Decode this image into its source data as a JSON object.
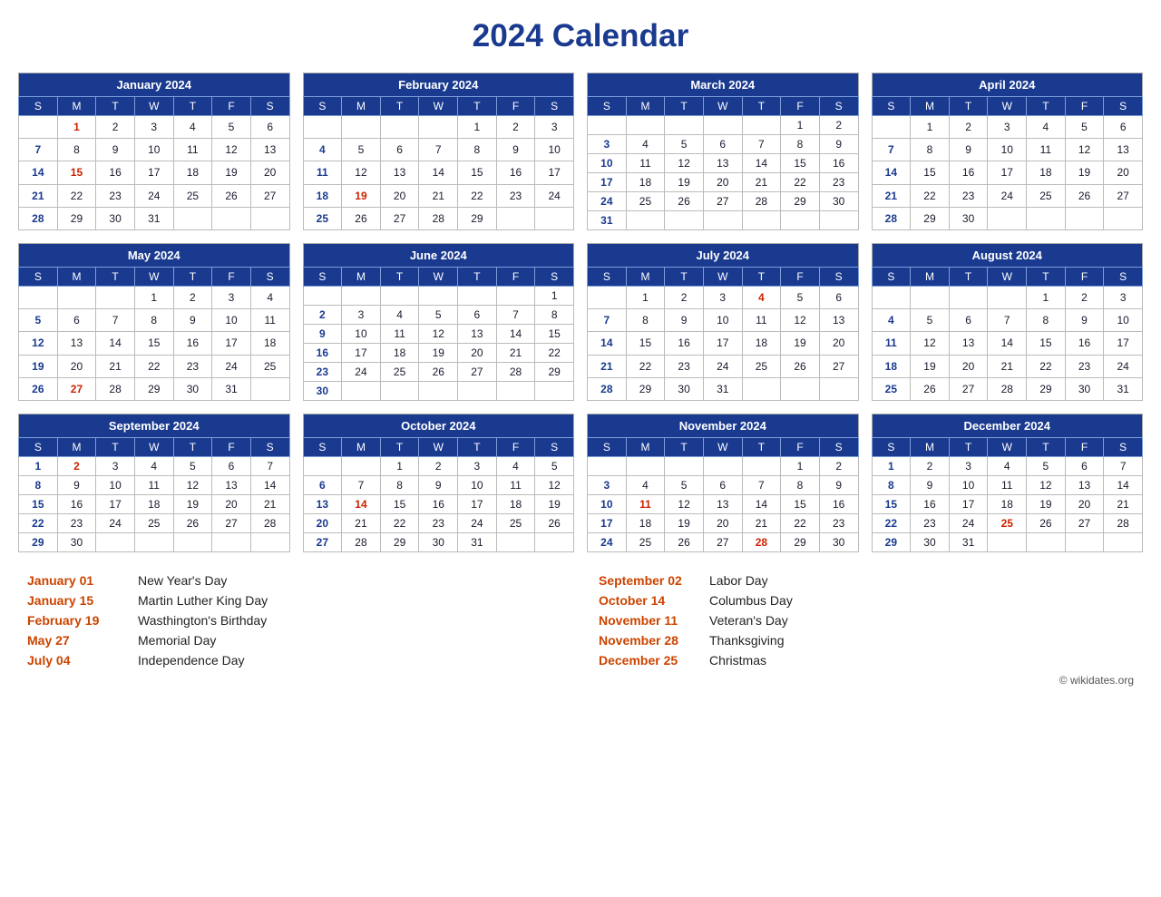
{
  "title": "2024 Calendar",
  "copyright": "© wikidates.org",
  "months": [
    {
      "name": "January 2024",
      "days_header": [
        "S",
        "M",
        "T",
        "W",
        "T",
        "F",
        "S"
      ],
      "weeks": [
        [
          "",
          "1",
          "2",
          "3",
          "4",
          "5",
          "6"
        ],
        [
          "7",
          "8",
          "9",
          "10",
          "11",
          "12",
          "13"
        ],
        [
          "14",
          "15",
          "16",
          "17",
          "18",
          "19",
          "20"
        ],
        [
          "21",
          "22",
          "23",
          "24",
          "25",
          "26",
          "27"
        ],
        [
          "28",
          "29",
          "30",
          "31",
          "",
          "",
          ""
        ]
      ],
      "holidays": [
        "1",
        "15"
      ],
      "sundays": [
        "7",
        "14",
        "21",
        "28"
      ]
    },
    {
      "name": "February 2024",
      "days_header": [
        "S",
        "M",
        "T",
        "W",
        "T",
        "F",
        "S"
      ],
      "weeks": [
        [
          "",
          "",
          "",
          "",
          "1",
          "2",
          "3"
        ],
        [
          "4",
          "5",
          "6",
          "7",
          "8",
          "9",
          "10"
        ],
        [
          "11",
          "12",
          "13",
          "14",
          "15",
          "16",
          "17"
        ],
        [
          "18",
          "19",
          "20",
          "21",
          "22",
          "23",
          "24"
        ],
        [
          "25",
          "26",
          "27",
          "28",
          "29",
          "",
          ""
        ]
      ],
      "holidays": [
        "19"
      ],
      "sundays": [
        "4",
        "11",
        "18",
        "25"
      ]
    },
    {
      "name": "March 2024",
      "days_header": [
        "S",
        "M",
        "T",
        "W",
        "T",
        "F",
        "S"
      ],
      "weeks": [
        [
          "",
          "",
          "",
          "",
          "",
          "1",
          "2"
        ],
        [
          "3",
          "4",
          "5",
          "6",
          "7",
          "8",
          "9"
        ],
        [
          "10",
          "11",
          "12",
          "13",
          "14",
          "15",
          "16"
        ],
        [
          "17",
          "18",
          "19",
          "20",
          "21",
          "22",
          "23"
        ],
        [
          "24",
          "25",
          "26",
          "27",
          "28",
          "29",
          "30"
        ],
        [
          "31",
          "",
          "",
          "",
          "",
          "",
          ""
        ]
      ],
      "holidays": [],
      "sundays": [
        "3",
        "10",
        "17",
        "24",
        "31"
      ]
    },
    {
      "name": "April 2024",
      "days_header": [
        "S",
        "M",
        "T",
        "W",
        "T",
        "F",
        "S"
      ],
      "weeks": [
        [
          "",
          "1",
          "2",
          "3",
          "4",
          "5",
          "6"
        ],
        [
          "7",
          "8",
          "9",
          "10",
          "11",
          "12",
          "13"
        ],
        [
          "14",
          "15",
          "16",
          "17",
          "18",
          "19",
          "20"
        ],
        [
          "21",
          "22",
          "23",
          "24",
          "25",
          "26",
          "27"
        ],
        [
          "28",
          "29",
          "30",
          "",
          "",
          "",
          ""
        ]
      ],
      "holidays": [],
      "sundays": [
        "7",
        "14",
        "21",
        "28"
      ]
    },
    {
      "name": "May 2024",
      "days_header": [
        "S",
        "M",
        "T",
        "W",
        "T",
        "F",
        "S"
      ],
      "weeks": [
        [
          "",
          "",
          "",
          "1",
          "2",
          "3",
          "4"
        ],
        [
          "5",
          "6",
          "7",
          "8",
          "9",
          "10",
          "11"
        ],
        [
          "12",
          "13",
          "14",
          "15",
          "16",
          "17",
          "18"
        ],
        [
          "19",
          "20",
          "21",
          "22",
          "23",
          "24",
          "25"
        ],
        [
          "26",
          "27",
          "28",
          "29",
          "30",
          "31",
          ""
        ]
      ],
      "holidays": [
        "27"
      ],
      "sundays": [
        "5",
        "12",
        "19",
        "26"
      ]
    },
    {
      "name": "June 2024",
      "days_header": [
        "S",
        "M",
        "T",
        "W",
        "T",
        "F",
        "S"
      ],
      "weeks": [
        [
          "",
          "",
          "",
          "",
          "",
          "",
          "1"
        ],
        [
          "2",
          "3",
          "4",
          "5",
          "6",
          "7",
          "8"
        ],
        [
          "9",
          "10",
          "11",
          "12",
          "13",
          "14",
          "15"
        ],
        [
          "16",
          "17",
          "18",
          "19",
          "20",
          "21",
          "22"
        ],
        [
          "23",
          "24",
          "25",
          "26",
          "27",
          "28",
          "29"
        ],
        [
          "30",
          "",
          "",
          "",
          "",
          "",
          ""
        ]
      ],
      "holidays": [],
      "sundays": [
        "2",
        "9",
        "16",
        "23",
        "30"
      ]
    },
    {
      "name": "July 2024",
      "days_header": [
        "S",
        "M",
        "T",
        "W",
        "T",
        "F",
        "S"
      ],
      "weeks": [
        [
          "",
          "1",
          "2",
          "3",
          "4",
          "5",
          "6"
        ],
        [
          "7",
          "8",
          "9",
          "10",
          "11",
          "12",
          "13"
        ],
        [
          "14",
          "15",
          "16",
          "17",
          "18",
          "19",
          "20"
        ],
        [
          "21",
          "22",
          "23",
          "24",
          "25",
          "26",
          "27"
        ],
        [
          "28",
          "29",
          "30",
          "31",
          "",
          "",
          ""
        ]
      ],
      "holidays": [
        "4"
      ],
      "sundays": [
        "7",
        "14",
        "21",
        "28"
      ]
    },
    {
      "name": "August 2024",
      "days_header": [
        "S",
        "M",
        "T",
        "W",
        "T",
        "F",
        "S"
      ],
      "weeks": [
        [
          "",
          "",
          "",
          "",
          "1",
          "2",
          "3"
        ],
        [
          "4",
          "5",
          "6",
          "7",
          "8",
          "9",
          "10"
        ],
        [
          "11",
          "12",
          "13",
          "14",
          "15",
          "16",
          "17"
        ],
        [
          "18",
          "19",
          "20",
          "21",
          "22",
          "23",
          "24"
        ],
        [
          "25",
          "26",
          "27",
          "28",
          "29",
          "30",
          "31"
        ]
      ],
      "holidays": [],
      "sundays": [
        "4",
        "11",
        "18",
        "25"
      ]
    },
    {
      "name": "September 2024",
      "days_header": [
        "S",
        "M",
        "T",
        "W",
        "T",
        "F",
        "S"
      ],
      "weeks": [
        [
          "1",
          "2",
          "3",
          "4",
          "5",
          "6",
          "7"
        ],
        [
          "8",
          "9",
          "10",
          "11",
          "12",
          "13",
          "14"
        ],
        [
          "15",
          "16",
          "17",
          "18",
          "19",
          "20",
          "21"
        ],
        [
          "22",
          "23",
          "24",
          "25",
          "26",
          "27",
          "28"
        ],
        [
          "29",
          "30",
          "",
          "",
          "",
          "",
          ""
        ]
      ],
      "holidays": [
        "2"
      ],
      "sundays": [
        "1",
        "8",
        "15",
        "22",
        "29"
      ]
    },
    {
      "name": "October 2024",
      "days_header": [
        "S",
        "M",
        "T",
        "W",
        "T",
        "F",
        "S"
      ],
      "weeks": [
        [
          "",
          "",
          "1",
          "2",
          "3",
          "4",
          "5"
        ],
        [
          "6",
          "7",
          "8",
          "9",
          "10",
          "11",
          "12"
        ],
        [
          "13",
          "14",
          "15",
          "16",
          "17",
          "18",
          "19"
        ],
        [
          "20",
          "21",
          "22",
          "23",
          "24",
          "25",
          "26"
        ],
        [
          "27",
          "28",
          "29",
          "30",
          "31",
          "",
          ""
        ]
      ],
      "holidays": [
        "14"
      ],
      "sundays": [
        "6",
        "13",
        "20",
        "27"
      ]
    },
    {
      "name": "November 2024",
      "days_header": [
        "S",
        "M",
        "T",
        "W",
        "T",
        "F",
        "S"
      ],
      "weeks": [
        [
          "",
          "",
          "",
          "",
          "",
          "1",
          "2"
        ],
        [
          "3",
          "4",
          "5",
          "6",
          "7",
          "8",
          "9"
        ],
        [
          "10",
          "11",
          "12",
          "13",
          "14",
          "15",
          "16"
        ],
        [
          "17",
          "18",
          "19",
          "20",
          "21",
          "22",
          "23"
        ],
        [
          "24",
          "25",
          "26",
          "27",
          "28",
          "29",
          "30"
        ]
      ],
      "holidays": [
        "11",
        "28"
      ],
      "sundays": [
        "3",
        "10",
        "17",
        "24"
      ]
    },
    {
      "name": "December 2024",
      "days_header": [
        "S",
        "M",
        "T",
        "W",
        "T",
        "F",
        "S"
      ],
      "weeks": [
        [
          "1",
          "2",
          "3",
          "4",
          "5",
          "6",
          "7"
        ],
        [
          "8",
          "9",
          "10",
          "11",
          "12",
          "13",
          "14"
        ],
        [
          "15",
          "16",
          "17",
          "18",
          "19",
          "20",
          "21"
        ],
        [
          "22",
          "23",
          "24",
          "25",
          "26",
          "27",
          "28"
        ],
        [
          "29",
          "30",
          "31",
          "",
          "",
          "",
          ""
        ]
      ],
      "holidays": [
        "25"
      ],
      "sundays": [
        "1",
        "8",
        "15",
        "22",
        "29"
      ]
    }
  ],
  "holidays_left": [
    {
      "date": "January 01",
      "name": "New Year's Day"
    },
    {
      "date": "January 15",
      "name": "Martin Luther King Day"
    },
    {
      "date": "February 19",
      "name": "Wasthington's Birthday"
    },
    {
      "date": "May 27",
      "name": "Memorial Day"
    },
    {
      "date": "July 04",
      "name": "Independence Day"
    }
  ],
  "holidays_right": [
    {
      "date": "September 02",
      "name": "Labor Day"
    },
    {
      "date": "October 14",
      "name": "Columbus Day"
    },
    {
      "date": "November 11",
      "name": "Veteran's Day"
    },
    {
      "date": "November 28",
      "name": "Thanksgiving"
    },
    {
      "date": "December 25",
      "name": "Christmas"
    }
  ]
}
